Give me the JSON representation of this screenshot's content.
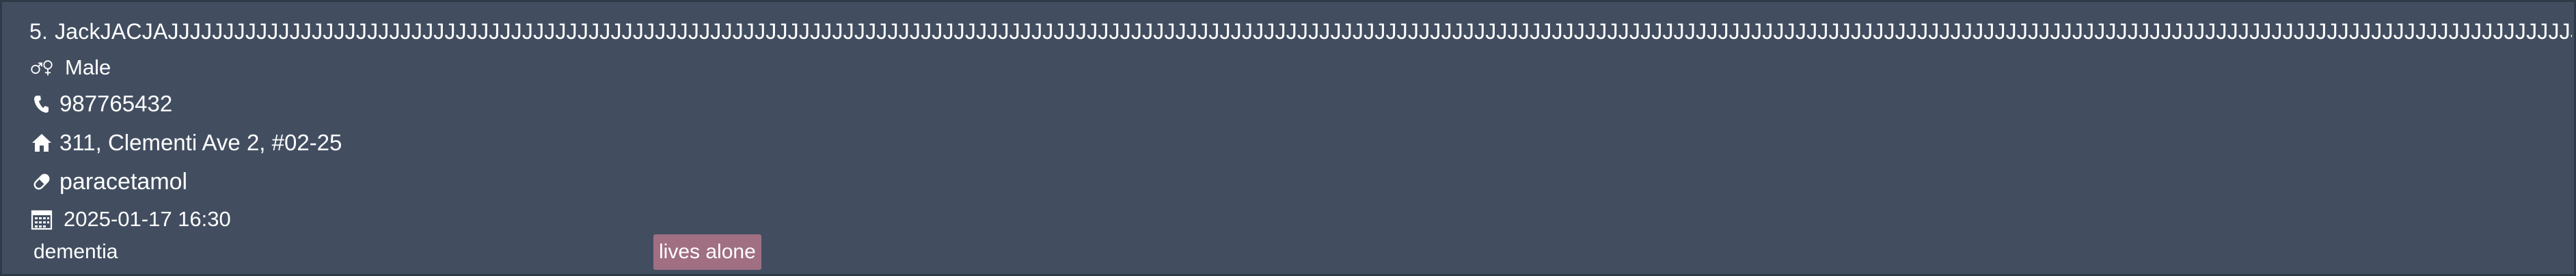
{
  "person": {
    "index": "5.",
    "name": "JackJACJAJJJJJJJJJJJJJJJJJJJJJJJJJJJJJJJJJJJJJJJJJJJJJJJJJJJJJJJJJJJJJJJJJJJJJJJJJJJJJJJJJJJJJJJJJJJJJJJJJJJJJJJJJJJJJJJJJJJJJJJJJJJJJJJJJJJJJJJJJJJJJJJJJJJJJJJJJJJJJJJJJJJJJJJJJJJJJJJJJJJJJJJJJJJJJJJJJJJJJJJJJJJJJJJJJJJJJJJJJJJJJJJJJJJJJJJJJJJJJJJJJJJJJJJJJJJJJJJJJJJJJJJJJJJJJJJJJJJJJJJJJJJJJJJJJJJJJJJJJJJJJJJJJJJJJJJJJJJJJJJJJJJJJJJJJJJJJJJJJJJJJJJJJJJJJJJJJJJJJJJJJJJJJJJJJJJJJJJJJJJJJJJJJJJJJJJJJJJJJ",
    "gender": "Male",
    "phone": "987765432",
    "address": "311, Clementi Ave 2, #02-25",
    "medication": "paracetamol",
    "datetime": "2025-01-17 16:30",
    "tags": [
      {
        "label": "dementia",
        "color": "#424e60"
      },
      {
        "label": "lives alone",
        "color": "#a06f82"
      }
    ]
  },
  "icons": {
    "gender": "gender-icon",
    "phone": "phone-icon",
    "address": "home-icon",
    "medication": "pill-icon",
    "datetime": "calendar-icon"
  },
  "colors": {
    "card_background": "#424e60",
    "card_border": "#2f3a49",
    "text": "#ffffff",
    "tag_highlight": "#a06f82"
  }
}
